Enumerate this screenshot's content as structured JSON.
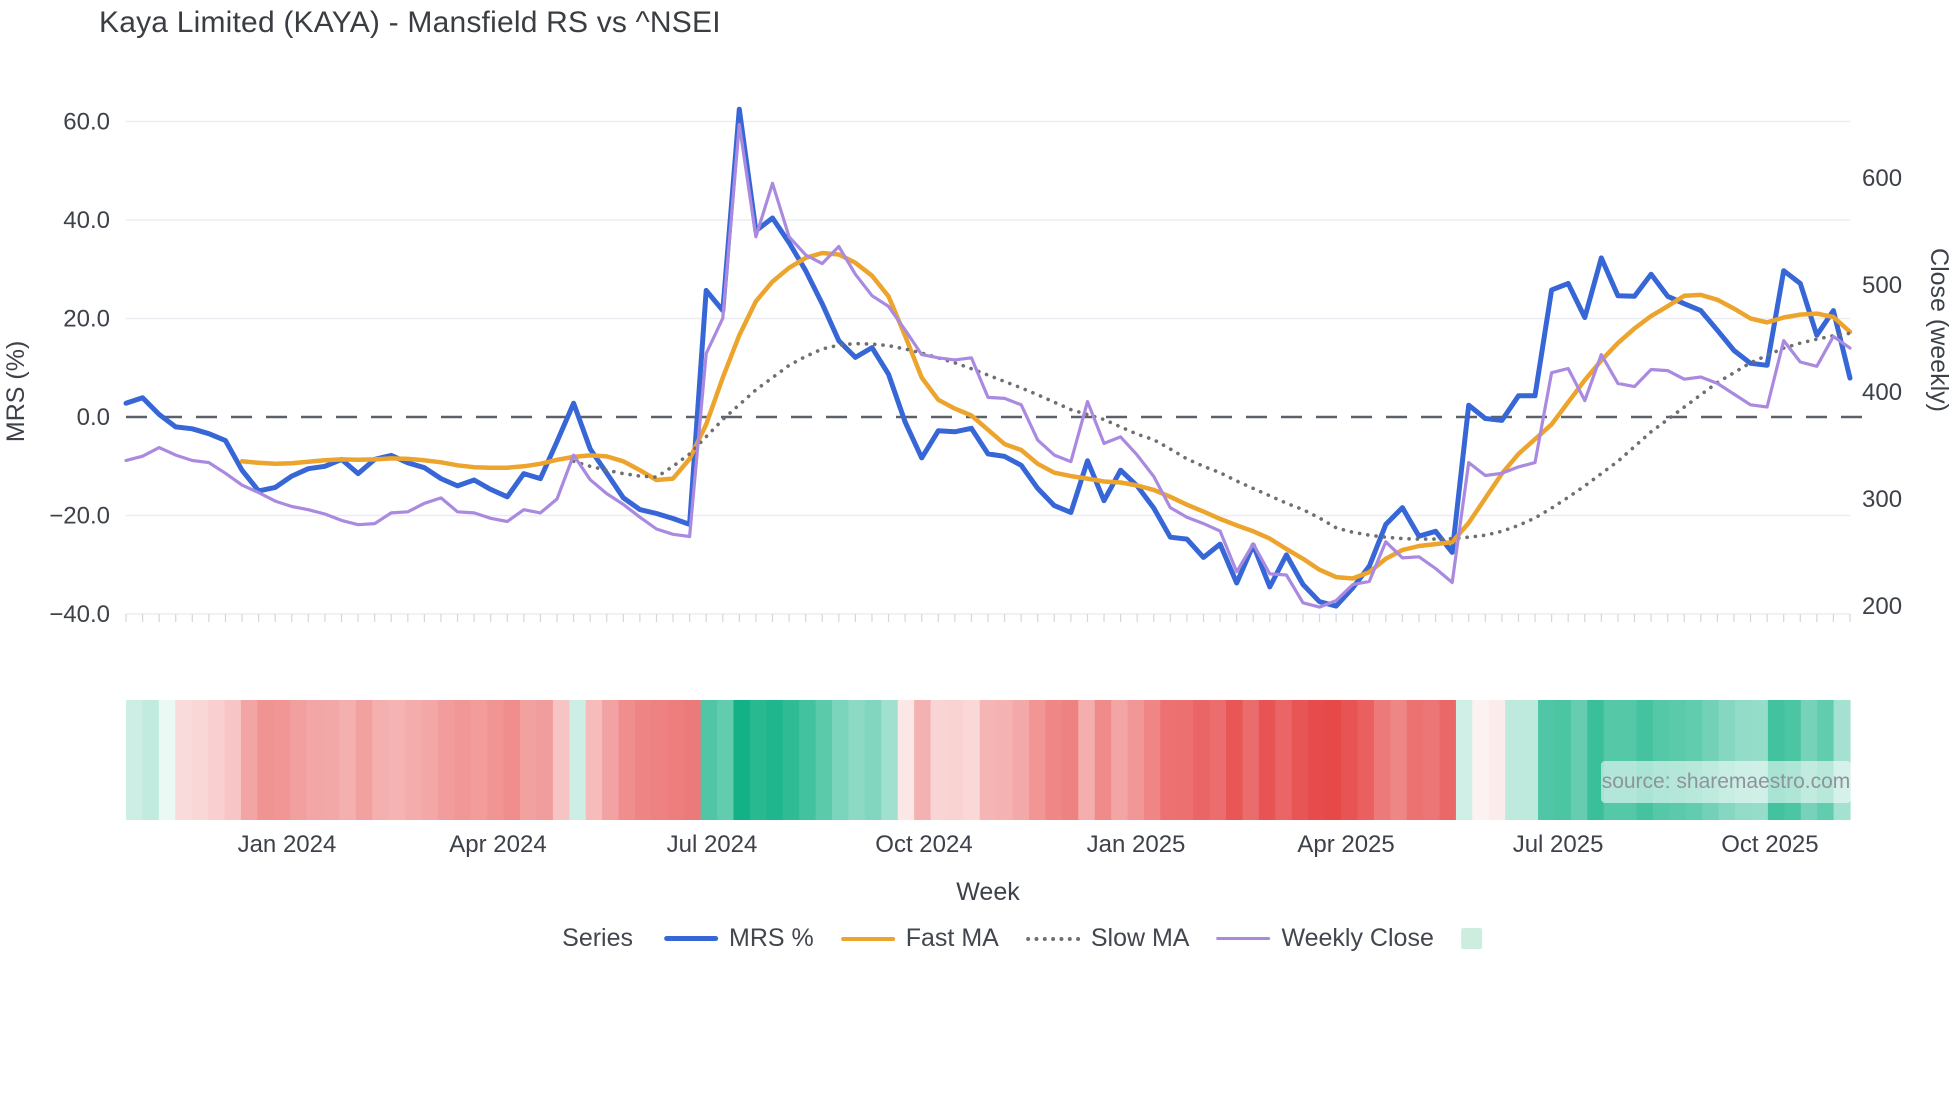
{
  "title": "Kaya Limited (KAYA) - Mansfield RS vs ^NSEI",
  "watermark": "source: sharemaestro.com",
  "axes": {
    "x_title": "Week",
    "y_left_title": "MRS (%)",
    "y_right_title": "Close (weekly)",
    "y_left_ticks": [
      "60.0",
      "40.0",
      "20.0",
      "0.0",
      "−20.0",
      "−40.0"
    ],
    "y_left_tick_values": [
      60,
      40,
      20,
      0,
      -20,
      -40
    ],
    "y_right_ticks": [
      "600",
      "500",
      "400",
      "300",
      "200"
    ],
    "y_right_tick_values": [
      600,
      500,
      400,
      300,
      200
    ],
    "x_tick_labels": [
      "Jan 2024",
      "Apr 2024",
      "Jul 2024",
      "Oct 2024",
      "Jan 2025",
      "Apr 2025",
      "Jul 2025",
      "Oct 2025"
    ]
  },
  "legend": {
    "title": "Series",
    "items": [
      {
        "name": "mrs",
        "label": "MRS %",
        "swatch": "line-blue"
      },
      {
        "name": "fast-ma",
        "label": "Fast MA",
        "swatch": "line-orange"
      },
      {
        "name": "slow-ma",
        "label": "Slow MA",
        "swatch": "line-dotted-gray"
      },
      {
        "name": "weekly-close",
        "label": "Weekly Close",
        "swatch": "line-purple"
      },
      {
        "name": "heat-strip",
        "label": "",
        "swatch": "square-mint"
      }
    ]
  },
  "colors": {
    "mrs_line": "#3766d6",
    "fast_ma_line": "#eca42d",
    "slow_ma_line": "#6f6f6f",
    "weekly_close_line": "#a98ae0",
    "zero_line": "#5c6069",
    "gridline": "#ebedf2",
    "tick_stub": "#d3d6dc",
    "heat_green_max": "#12b286",
    "heat_red_max": "#e64545",
    "legend_heat_swatch": "#cdeede",
    "tick_text": "#3d4149",
    "title_text": "#3a3d42",
    "watermark_text": "#8d949c"
  },
  "chart_data": {
    "type": "line",
    "title": "Kaya Limited (KAYA) - Mansfield RS vs ^NSEI",
    "xlabel": "Week",
    "ylabel_left": "MRS (%)",
    "ylabel_right": "Close (weekly)",
    "x_unit": "week_index",
    "weeks": 105,
    "x_tick_labels": [
      "Jan 2024",
      "Apr 2024",
      "Jul 2024",
      "Oct 2024",
      "Jan 2025",
      "Apr 2025",
      "Jul 2025",
      "Oct 2025"
    ],
    "x_tick_positions_week": [
      9.71,
      22.44,
      35.35,
      48.14,
      60.93,
      73.6,
      86.39,
      99.17
    ],
    "y_left_ticks": [
      60,
      40,
      20,
      0,
      -20,
      -40
    ],
    "y_left_range": [
      -49,
      67
    ],
    "y_right_ticks": [
      600,
      500,
      400,
      300,
      200
    ],
    "y_right_range": [
      195,
      655
    ],
    "grid": "horizontal-only",
    "zero_reference_line": 0,
    "legend_position": "bottom-center",
    "series": [
      {
        "name": "MRS %",
        "axis": "left",
        "style": "solid",
        "width": 5,
        "color": "#3766d6",
        "values": [
          2.8,
          3.9,
          0.5,
          -2,
          -2.4,
          -3.4,
          -4.8,
          -10.8,
          -15,
          -14.3,
          -12,
          -10.5,
          -10,
          -8.6,
          -11.5,
          -8.6,
          -7.8,
          -9.3,
          -10.3,
          -12.5,
          -14,
          -12.8,
          -14.7,
          -16.2,
          -11.5,
          -12.5,
          -5,
          2.8,
          -6.5,
          -11.4,
          -16.4,
          -18.8,
          -19.6,
          -20.6,
          -21.8,
          25.7,
          21.6,
          62.5,
          37.8,
          40.4,
          35.4,
          29.7,
          23,
          15.5,
          12.1,
          14.1,
          8.7,
          -1,
          -8.3,
          -2.8,
          -3,
          -2.3,
          -7.5,
          -8,
          -9.8,
          -14.5,
          -18,
          -19.4,
          -8.9,
          -17,
          -10.8,
          -14,
          -18.5,
          -24.4,
          -24.8,
          -28.5,
          -25.8,
          -33.7,
          -26,
          -34.5,
          -28,
          -34,
          -37.5,
          -38.4,
          -34.7,
          -30.3,
          -21.8,
          -18.4,
          -24.2,
          -23.2,
          -27.5,
          2.4,
          -0.3,
          -0.7,
          4.3,
          4.3,
          25.8,
          27.1,
          20.2,
          32.3,
          24.6,
          24.5,
          29,
          24.5,
          23,
          21.6,
          17.6,
          13.5,
          10.9,
          10.5,
          29.7,
          27.1,
          16.6,
          21.6,
          7.9
        ]
      },
      {
        "name": "Fast MA",
        "axis": "left",
        "style": "solid",
        "width": 4.5,
        "color": "#eca42d",
        "values": [
          null,
          null,
          null,
          null,
          null,
          null,
          null,
          -9,
          -9.3,
          -9.5,
          -9.4,
          -9.1,
          -8.8,
          -8.6,
          -8.7,
          -8.6,
          -8.4,
          -8.5,
          -8.8,
          -9.2,
          -9.8,
          -10.2,
          -10.3,
          -10.3,
          -10,
          -9.5,
          -8.7,
          -8.1,
          -7.8,
          -8,
          -9,
          -10.8,
          -12.8,
          -12.5,
          -8.5,
          -1.5,
          8,
          16.6,
          23.5,
          27.5,
          30.3,
          32.3,
          33.3,
          33,
          31.3,
          28.7,
          24.5,
          16.5,
          8,
          3.5,
          1.7,
          0.3,
          -2.6,
          -5.5,
          -6.7,
          -9.5,
          -11.3,
          -12,
          -12.5,
          -13.1,
          -13.3,
          -13.9,
          -14.8,
          -16.2,
          -17.8,
          -19.2,
          -20.7,
          -22,
          -23.2,
          -24.7,
          -26.8,
          -28.8,
          -31,
          -32.5,
          -32.8,
          -31.5,
          -28.8,
          -27,
          -26.2,
          -25.8,
          -25.4,
          -21.5,
          -16.5,
          -11.5,
          -7.5,
          -4.5,
          -1.5,
          3,
          7.5,
          11.5,
          15,
          18,
          20.5,
          22.5,
          24.6,
          24.8,
          23.8,
          22,
          20,
          19.2,
          20.2,
          20.8,
          21,
          20.3,
          17.3
        ]
      },
      {
        "name": "Slow MA",
        "axis": "left",
        "style": "dotted",
        "width": 3.6,
        "color": "#6f6f6f",
        "values": [
          null,
          null,
          null,
          null,
          null,
          null,
          null,
          null,
          null,
          null,
          null,
          null,
          null,
          null,
          null,
          null,
          null,
          null,
          null,
          null,
          null,
          null,
          null,
          null,
          null,
          null,
          null,
          -9,
          -10,
          -10.8,
          -11.5,
          -12,
          -12.2,
          -10,
          -7.5,
          -4,
          -0.5,
          2.5,
          5.5,
          8,
          10.5,
          12.3,
          13.8,
          14.6,
          14.9,
          14.8,
          14.5,
          13.8,
          13,
          12,
          11,
          9.8,
          8.5,
          7.2,
          5.9,
          4.5,
          3,
          1.5,
          0.5,
          -0.5,
          -2,
          -3.5,
          -4.6,
          -6.5,
          -8.5,
          -10,
          -11.3,
          -13,
          -14.5,
          -16,
          -17.5,
          -18.8,
          -20.5,
          -22.5,
          -23.4,
          -24,
          -24.4,
          -24.7,
          -24.8,
          -24.8,
          -24.7,
          -24.4,
          -24,
          -23.2,
          -22,
          -20.5,
          -18.5,
          -16.3,
          -14,
          -11.5,
          -9,
          -6,
          -3,
          -0.5,
          2,
          4.5,
          7,
          9,
          11,
          12.5,
          14,
          15,
          15.8,
          16.5,
          17
        ]
      },
      {
        "name": "Weekly Close",
        "axis": "right",
        "style": "solid",
        "width": 3.2,
        "color": "#a98ae0",
        "values": [
          336,
          340,
          348,
          341,
          336,
          334,
          324,
          313,
          306,
          298,
          293,
          290,
          286,
          280,
          276,
          277,
          287,
          288,
          296,
          301,
          288,
          287,
          282,
          279,
          290,
          287,
          300,
          341,
          318,
          305,
          295,
          283,
          272,
          267,
          265,
          436,
          469,
          650,
          545,
          595,
          545,
          528,
          520,
          536,
          510,
          490,
          480,
          458,
          435,
          432,
          430,
          432,
          395,
          394,
          388,
          355,
          341,
          335,
          391,
          352,
          358,
          341,
          321,
          292,
          283,
          277,
          270,
          232,
          258,
          230,
          229,
          203,
          199,
          205,
          220,
          223,
          260,
          245,
          246,
          235,
          222,
          334,
          322,
          324,
          330,
          334,
          418,
          422,
          392,
          435,
          408,
          405,
          421,
          420,
          412,
          414,
          408,
          398,
          388,
          386,
          448,
          428,
          424,
          452,
          441
        ]
      }
    ],
    "heatmap_strip": {
      "description": "weekly relative-strength heat band below chart; green = positive MRS, red = negative MRS, intensity scales with magnitude",
      "derived_from": "MRS %",
      "cells": 105
    }
  }
}
